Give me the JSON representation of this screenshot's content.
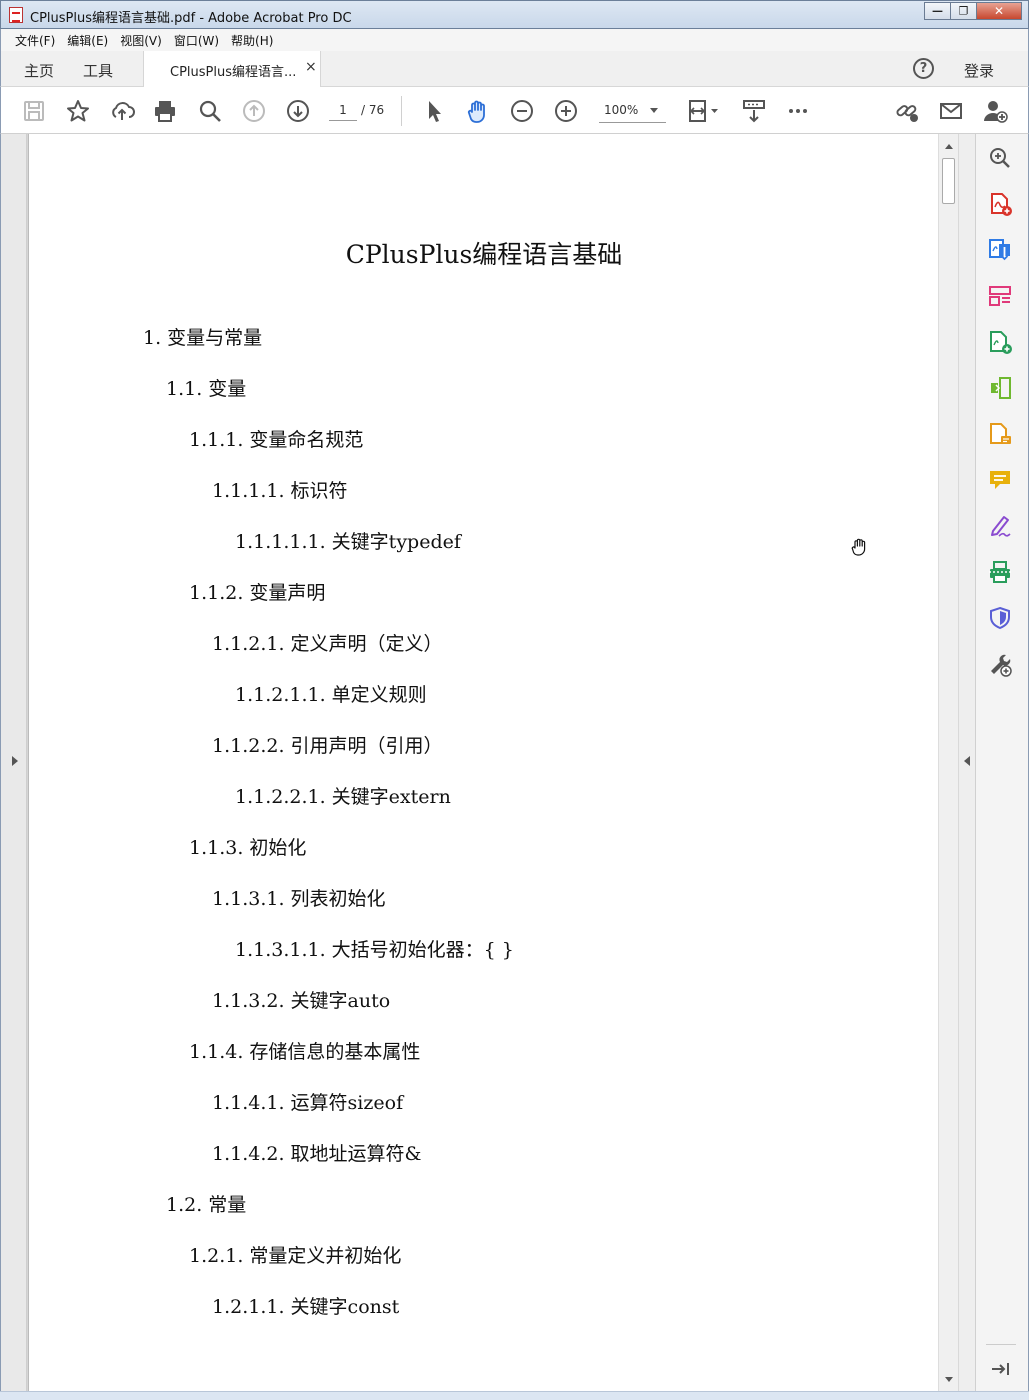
{
  "window": {
    "title": "CPlusPlus编程语言基础.pdf - Adobe Acrobat Pro DC"
  },
  "menu": [
    "文件(F)",
    "编辑(E)",
    "视图(V)",
    "窗口(W)",
    "帮助(H)"
  ],
  "tabs": {
    "home": "主页",
    "tools": "工具",
    "document": "CPlusPlus编程语言...",
    "close": "×",
    "login": "登录"
  },
  "toolbar": {
    "page_current": "1",
    "page_total": "/ 76",
    "zoom": "100%"
  },
  "document": {
    "title": "CPlusPlus编程语言基础",
    "toc": [
      "1.  变量与常量",
      "1.1.  变量",
      "1.1.1.  变量命名规范",
      "1.1.1.1.  标识符",
      "1.1.1.1.1.  关键字typedef",
      "1.1.2.  变量声明",
      "1.1.2.1.  定义声明（定义）",
      "1.1.2.1.1.  单定义规则",
      "1.1.2.2.  引用声明（引用）",
      "1.1.2.2.1.  关键字extern",
      "1.1.3.  初始化",
      "1.1.3.1.  列表初始化",
      "1.1.3.1.1.  大括号初始化器：{ }",
      "1.1.3.2.  关键字auto",
      "1.1.4.  存储信息的基本属性",
      "1.1.4.1.  运算符sizeof",
      "1.1.4.2.  取地址运算符&",
      "1.2.  常量",
      "1.2.1.  常量定义并初始化",
      "1.2.1.1.  关键字const"
    ]
  },
  "icons": {
    "toolbar": [
      "save-icon",
      "bookmark-star-icon",
      "upload-cloud-icon",
      "print-icon",
      "search-icon",
      "page-up-icon",
      "page-down-icon",
      "select-cursor-icon",
      "hand-tool-icon",
      "zoom-out-icon",
      "zoom-in-icon",
      "fit-page-icon",
      "scroll-mode-icon",
      "more-icon",
      "share-link-icon",
      "email-icon",
      "add-user-icon"
    ],
    "tools_pane": [
      "zoom-search-icon",
      "create-pdf-icon",
      "export-pdf-icon",
      "organize-pages-icon",
      "combine-files-icon",
      "edit-pdf-icon",
      "send-for-comment-icon",
      "comment-icon",
      "fill-sign-icon",
      "scan-ocr-icon",
      "protect-icon",
      "more-tools-icon",
      "collapse-pane-icon"
    ]
  },
  "colors": {
    "accent_blue": "#2d6fd6",
    "pdf_red": "#d9342b",
    "tool_blue": "#2f7be5",
    "tool_pink": "#e0397a",
    "tool_green": "#2a9d5c",
    "tool_orange": "#e59a1b",
    "tool_yellow": "#e8b10c",
    "tool_purple": "#8a4bd0",
    "tool_indigo": "#5a5fd6"
  }
}
